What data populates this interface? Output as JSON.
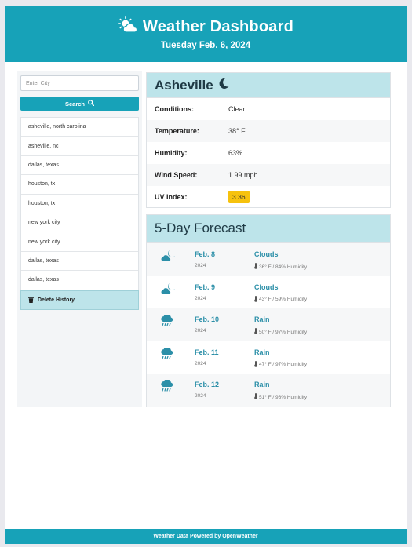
{
  "header": {
    "title": "Weather Dashboard",
    "date": "Tuesday Feb. 6, 2024",
    "icon": "sun-cloud-icon"
  },
  "sidebar": {
    "input_placeholder": "Enter City",
    "search_label": "Search",
    "history": [
      "asheville, north carolina",
      "asheville, nc",
      "dallas, texas",
      "houston, tx",
      "houston, tx",
      "new york city",
      "new york city",
      "dallas, texas",
      "dallas, texas"
    ],
    "delete_label": "Delete History"
  },
  "current": {
    "city": "Asheville",
    "icon": "moon-icon",
    "rows": [
      {
        "label": "Conditions:",
        "value": "Clear"
      },
      {
        "label": "Temperature:",
        "value": "38° F"
      },
      {
        "label": "Humidity:",
        "value": "63%"
      },
      {
        "label": "Wind Speed:",
        "value": "1.99 mph"
      },
      {
        "label": "UV Index:",
        "value": "3.36"
      }
    ]
  },
  "forecast": {
    "title": "5-Day Forecast",
    "days": [
      {
        "date": "Feb. 8",
        "year": "2024",
        "condition": "Clouds",
        "meta": "36° F / 84% Humidity",
        "icon": "moon-cloud-icon"
      },
      {
        "date": "Feb. 9",
        "year": "2024",
        "condition": "Clouds",
        "meta": "43° F / 59% Humidity",
        "icon": "moon-cloud-icon"
      },
      {
        "date": "Feb. 10",
        "year": "2024",
        "condition": "Rain",
        "meta": "50° F / 97% Humidity",
        "icon": "rain-cloud-icon"
      },
      {
        "date": "Feb. 11",
        "year": "2024",
        "condition": "Rain",
        "meta": "47° F / 97% Humidity",
        "icon": "rain-cloud-icon"
      },
      {
        "date": "Feb. 12",
        "year": "2024",
        "condition": "Rain",
        "meta": "51° F / 96% Humidity",
        "icon": "rain-cloud-icon"
      }
    ]
  },
  "footer": {
    "text": "Weather Data Powered by OpenWeather"
  },
  "colors": {
    "primary": "#17a2b8",
    "light": "#bde4ea",
    "uv": "#f6c20e"
  }
}
